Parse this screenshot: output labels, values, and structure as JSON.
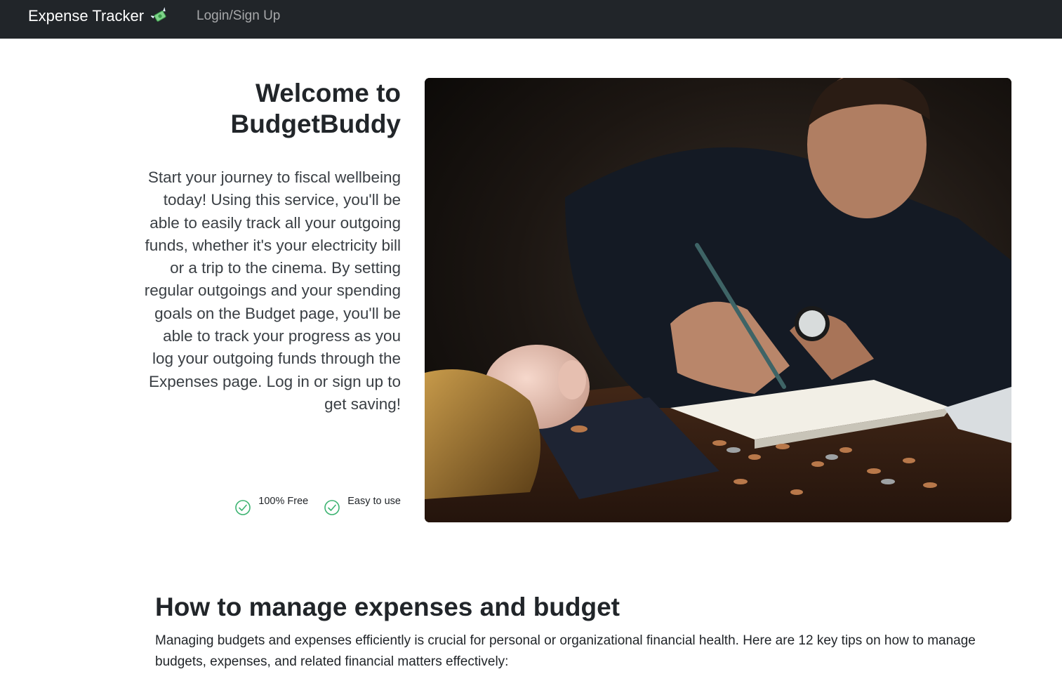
{
  "navbar": {
    "brand": "Expense Tracker",
    "brand_icon": "flying-money-icon",
    "links": [
      {
        "label": "Login/Sign Up"
      }
    ]
  },
  "hero": {
    "title": "Welcome to BudgetBuddy",
    "lead": "Start your journey to fiscal wellbeing today! Using this service, you'll be able to easily track all your outgoing funds, whether it's your electricity bill or a trip to the cinema. By setting regular outgoings and your spending goals on the Budget page, you'll be able to track your progress as you log your outgoing funds through the Expenses page. Log in or sign up to get saving!",
    "features": [
      {
        "label": "100% Free",
        "icon": "check-circle-icon"
      },
      {
        "label": "Easy to use",
        "icon": "check-circle-icon"
      }
    ],
    "image_subject": "man-writing-in-notebook-with-piggy-bank-and-coins"
  },
  "section": {
    "title": "How to manage expenses and budget",
    "body": "Managing budgets and expenses efficiently is crucial for personal or organizational financial health. Here are 12 key tips on how to manage budgets, expenses, and related financial matters effectively:"
  },
  "colors": {
    "navbar_bg": "#212529",
    "check_green": "#3cb371",
    "text_dark": "#212529"
  }
}
